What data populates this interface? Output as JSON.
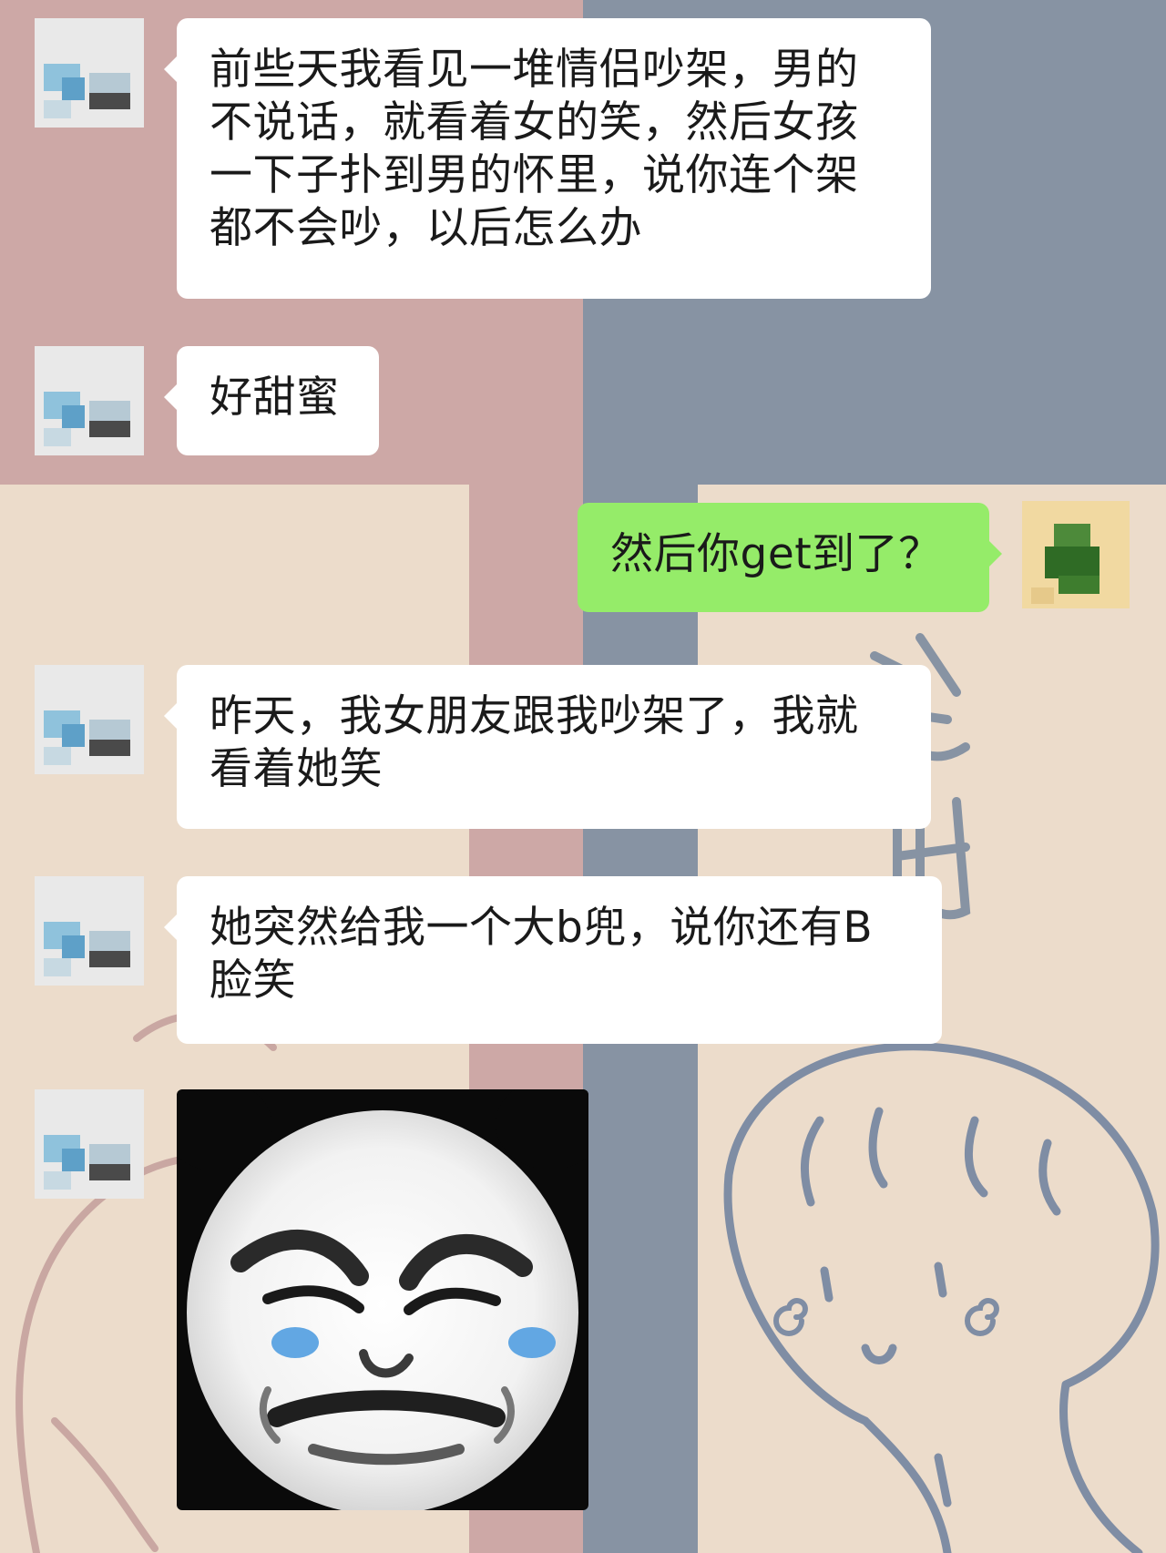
{
  "colors": {
    "wallpaper_pink": "#cda8a6",
    "wallpaper_slate": "#8793a3",
    "wallpaper_beige": "#ecdccb",
    "bubble_incoming": "#ffffff",
    "bubble_outgoing": "#95ec69",
    "tear_blue": "#62a7e3"
  },
  "messages": [
    {
      "side": "left",
      "text": "前些天我看见一堆情侣吵架，男的\n不说话，就看着女的笑，然后女孩\n一下子扑到男的怀里，说你连个架\n都不会吵，以后怎么办"
    },
    {
      "side": "left",
      "text": "好甜蜜"
    },
    {
      "side": "right",
      "text": "然后你get到了？"
    },
    {
      "side": "left",
      "text": "昨天，我女朋友跟我吵架了，我就\n看着她笑"
    },
    {
      "side": "left",
      "text": "她突然给我一个大b兜，说你还有B\n脸笑"
    },
    {
      "side": "left",
      "type": "sticker",
      "sticker": "panda-face-crying-meme"
    }
  ]
}
